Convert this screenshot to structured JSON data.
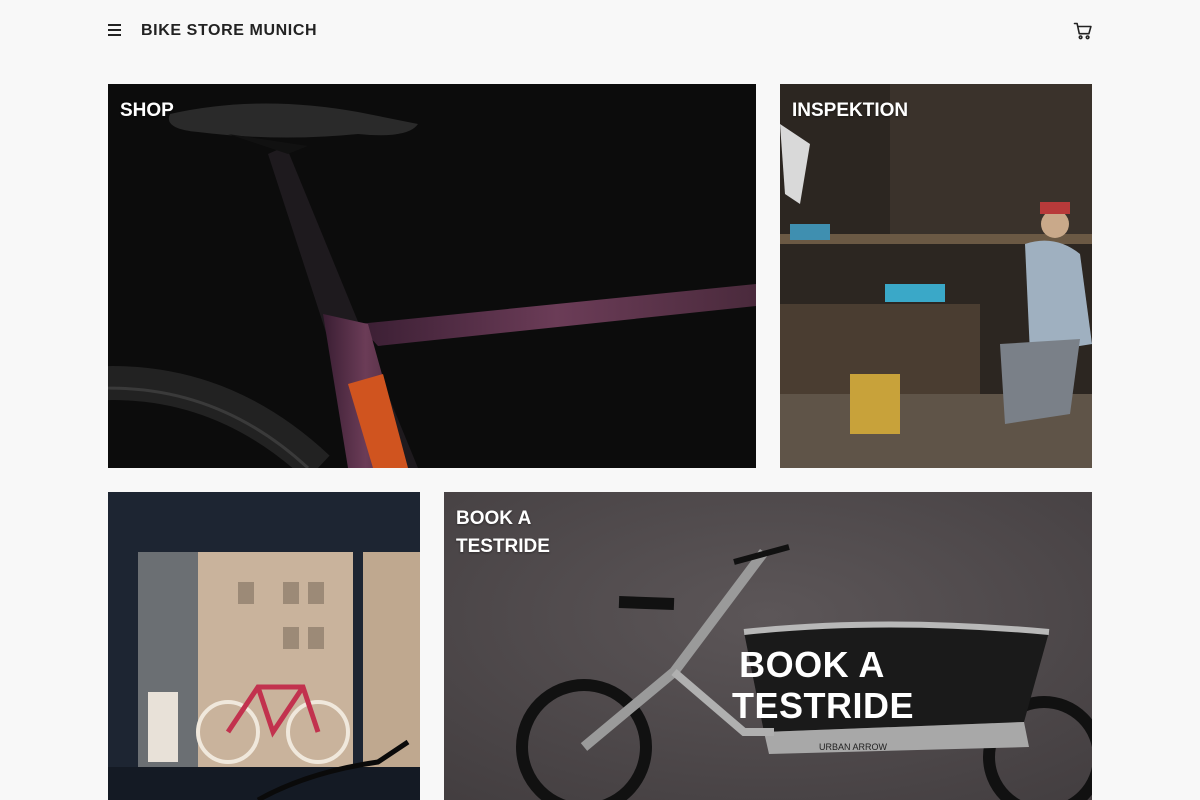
{
  "header": {
    "brand": "BIKE STORE MUNICH",
    "menu_icon": "hamburger-menu-icon",
    "cart_icon": "shopping-cart-icon"
  },
  "tiles": [
    {
      "label": "SHOP",
      "image": "bike-frame-closeup"
    },
    {
      "label": "INSPEKTION",
      "image": "bike-workshop-mechanic"
    },
    {
      "label": "",
      "image": "store-window-bicycle"
    },
    {
      "label": "BOOK A TESTRIDE",
      "image": "urban-arrow-cargo-bike",
      "banner": "BOOK A TESTRIDE",
      "brand_on_bike": "URBAN ARROW"
    }
  ],
  "colors": {
    "background": "#f8f8f8",
    "text": "#222222",
    "label": "#ffffff"
  }
}
